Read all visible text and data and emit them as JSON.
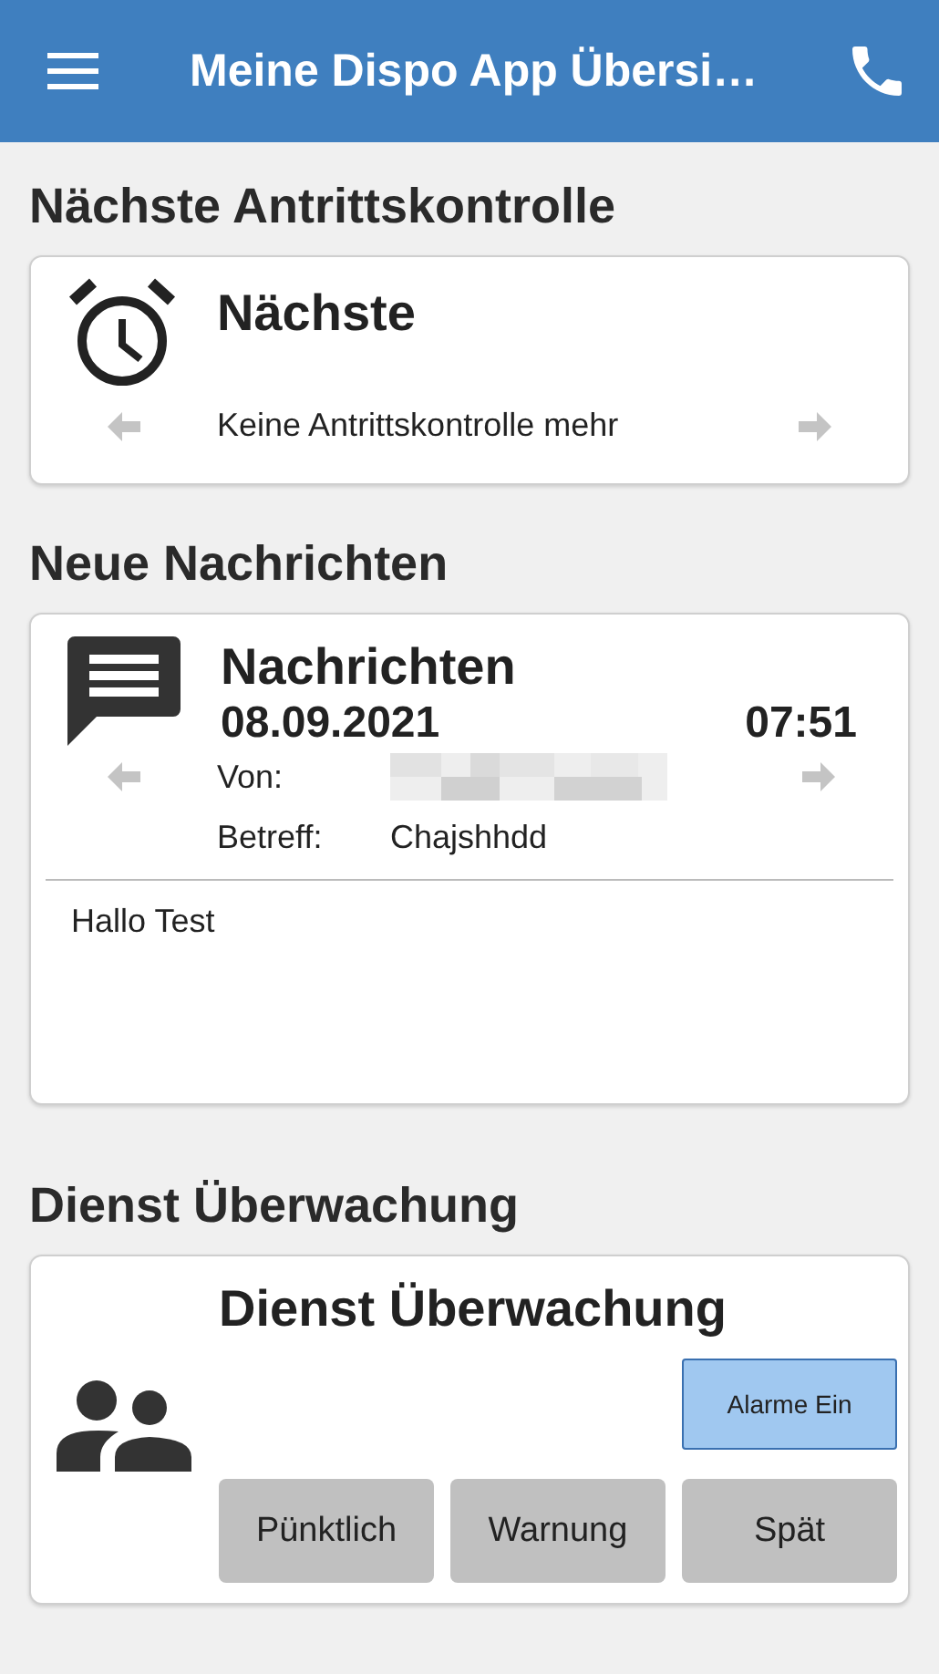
{
  "app_bar": {
    "title": "Meine Dispo App Übersi…"
  },
  "sections": [
    {
      "kind": "check",
      "heading": "Nächste Antrittskontrolle",
      "card": {
        "title": "Nächste",
        "text": "Keine Antrittskontrolle mehr"
      }
    },
    {
      "kind": "message",
      "heading": "Neue Nachrichten",
      "card": {
        "title": "Nachrichten",
        "date": "08.09.2021",
        "time": "07:51",
        "from_label": "Von:",
        "subject_label": "Betreff:",
        "subject": "Chajshhdd",
        "body": "Hallo Test"
      }
    },
    {
      "kind": "monitor",
      "heading": "Dienst Überwachung",
      "card": {
        "title": "Dienst Überwachung",
        "alarm": {
          "label": "Alarme Ein",
          "on": true
        },
        "buttons": [
          {
            "label": "Pünktlich"
          },
          {
            "label": "Warnung"
          },
          {
            "label": "Spät"
          }
        ]
      }
    }
  ]
}
